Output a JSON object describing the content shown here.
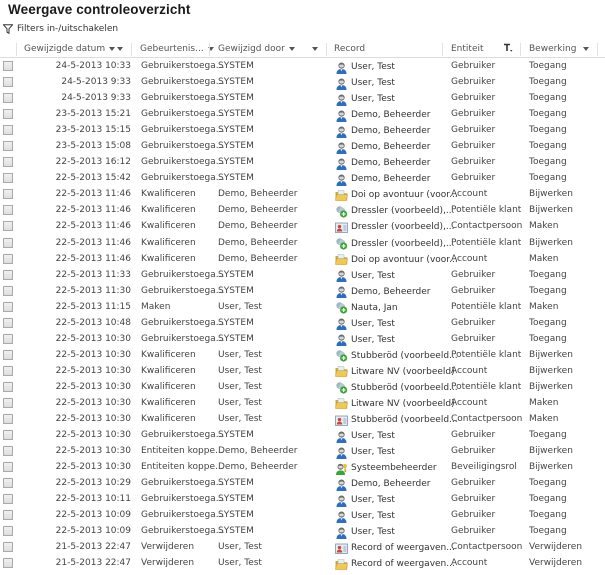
{
  "page": {
    "title": "Weergave controleoverzicht",
    "filter_toggle_label": "Filters in-/uitschakelen"
  },
  "colors": {
    "user_icon_blue": "#2b6fc2",
    "user_icon_gray": "#6b6b6b",
    "folder_yellow": "#f2c94c",
    "lead_green": "#38a832",
    "contact_red": "#c9493a"
  },
  "columns": [
    {
      "key": "date",
      "label": "Gewijzigde datum",
      "sortable": true
    },
    {
      "key": "event",
      "label": "Gebeurtenis...",
      "sortable": true
    },
    {
      "key": "changed_by",
      "label": "Gewijzigd door",
      "sortable": true
    },
    {
      "key": "record",
      "label": "Record",
      "sortable": false
    },
    {
      "key": "entity",
      "label": "Entiteit",
      "filter_active": true
    },
    {
      "key": "operation",
      "label": "Bewerking",
      "sortable": false
    }
  ],
  "rows": [
    {
      "date": "24-5-2013 10:33",
      "event": "Gebruikerstoega...",
      "changed_by": "SYSTEM",
      "record_icon": "user-icon",
      "record": "User, Test",
      "entity": "Gebruiker",
      "operation": "Toegang"
    },
    {
      "date": "24-5-2013 9:33",
      "event": "Gebruikerstoega...",
      "changed_by": "SYSTEM",
      "record_icon": "user-icon",
      "record": "User, Test",
      "entity": "Gebruiker",
      "operation": "Toegang"
    },
    {
      "date": "24-5-2013 9:33",
      "event": "Gebruikerstoega...",
      "changed_by": "SYSTEM",
      "record_icon": "user-icon",
      "record": "User, Test",
      "entity": "Gebruiker",
      "operation": "Toegang"
    },
    {
      "date": "23-5-2013 15:21",
      "event": "Gebruikerstoega...",
      "changed_by": "SYSTEM",
      "record_icon": "user-icon",
      "record": "Demo, Beheerder",
      "entity": "Gebruiker",
      "operation": "Toegang"
    },
    {
      "date": "23-5-2013 15:15",
      "event": "Gebruikerstoega...",
      "changed_by": "SYSTEM",
      "record_icon": "user-icon",
      "record": "Demo, Beheerder",
      "entity": "Gebruiker",
      "operation": "Toegang"
    },
    {
      "date": "23-5-2013 15:08",
      "event": "Gebruikerstoega...",
      "changed_by": "SYSTEM",
      "record_icon": "user-icon",
      "record": "Demo, Beheerder",
      "entity": "Gebruiker",
      "operation": "Toegang"
    },
    {
      "date": "22-5-2013 16:12",
      "event": "Gebruikerstoega...",
      "changed_by": "SYSTEM",
      "record_icon": "user-icon",
      "record": "Demo, Beheerder",
      "entity": "Gebruiker",
      "operation": "Toegang"
    },
    {
      "date": "22-5-2013 15:42",
      "event": "Gebruikerstoega...",
      "changed_by": "SYSTEM",
      "record_icon": "user-icon",
      "record": "Demo, Beheerder",
      "entity": "Gebruiker",
      "operation": "Toegang"
    },
    {
      "date": "22-5-2013 11:46",
      "event": "Kwalificeren",
      "changed_by": "Demo, Beheerder",
      "record_icon": "account-icon",
      "record": "Doi op avontuur (voor...",
      "entity": "Account",
      "operation": "Bijwerken"
    },
    {
      "date": "22-5-2013 11:46",
      "event": "Kwalificeren",
      "changed_by": "Demo, Beheerder",
      "record_icon": "lead-icon",
      "record": "Dressler (voorbeeld),...",
      "entity": "Potentiële klant",
      "operation": "Bijwerken"
    },
    {
      "date": "22-5-2013 11:46",
      "event": "Kwalificeren",
      "changed_by": "Demo, Beheerder",
      "record_icon": "contact-icon",
      "record": "Dressler (voorbeeld),...",
      "entity": "Contactpersoon",
      "operation": "Maken"
    },
    {
      "date": "22-5-2013 11:46",
      "event": "Kwalificeren",
      "changed_by": "Demo, Beheerder",
      "record_icon": "lead-icon",
      "record": "Dressler (voorbeeld),...",
      "entity": "Potentiële klant",
      "operation": "Bijwerken"
    },
    {
      "date": "22-5-2013 11:46",
      "event": "Kwalificeren",
      "changed_by": "Demo, Beheerder",
      "record_icon": "account-icon",
      "record": "Doi op avontuur (voor...",
      "entity": "Account",
      "operation": "Maken"
    },
    {
      "date": "22-5-2013 11:33",
      "event": "Gebruikerstoega...",
      "changed_by": "SYSTEM",
      "record_icon": "user-icon",
      "record": "User, Test",
      "entity": "Gebruiker",
      "operation": "Toegang"
    },
    {
      "date": "22-5-2013 11:30",
      "event": "Gebruikerstoega...",
      "changed_by": "SYSTEM",
      "record_icon": "user-icon",
      "record": "Demo, Beheerder",
      "entity": "Gebruiker",
      "operation": "Toegang"
    },
    {
      "date": "22-5-2013 11:15",
      "event": "Maken",
      "changed_by": "User, Test",
      "record_icon": "lead-icon",
      "record": "Nauta, Jan",
      "entity": "Potentiële klant",
      "operation": "Maken"
    },
    {
      "date": "22-5-2013 10:48",
      "event": "Gebruikerstoega...",
      "changed_by": "SYSTEM",
      "record_icon": "user-icon",
      "record": "User, Test",
      "entity": "Gebruiker",
      "operation": "Toegang"
    },
    {
      "date": "22-5-2013 10:30",
      "event": "Gebruikerstoega...",
      "changed_by": "SYSTEM",
      "record_icon": "user-icon",
      "record": "User, Test",
      "entity": "Gebruiker",
      "operation": "Toegang"
    },
    {
      "date": "22-5-2013 10:30",
      "event": "Kwalificeren",
      "changed_by": "User, Test",
      "record_icon": "lead-icon",
      "record": "Stubberöd (voorbeeld...",
      "entity": "Potentiële klant",
      "operation": "Bijwerken"
    },
    {
      "date": "22-5-2013 10:30",
      "event": "Kwalificeren",
      "changed_by": "User, Test",
      "record_icon": "account-icon",
      "record": "Litware NV (voorbeeld)",
      "entity": "Account",
      "operation": "Bijwerken"
    },
    {
      "date": "22-5-2013 10:30",
      "event": "Kwalificeren",
      "changed_by": "User, Test",
      "record_icon": "lead-icon",
      "record": "Stubberöd (voorbeeld...",
      "entity": "Potentiële klant",
      "operation": "Bijwerken"
    },
    {
      "date": "22-5-2013 10:30",
      "event": "Kwalificeren",
      "changed_by": "User, Test",
      "record_icon": "account-icon",
      "record": "Litware NV (voorbeeld)",
      "entity": "Account",
      "operation": "Maken"
    },
    {
      "date": "22-5-2013 10:30",
      "event": "Kwalificeren",
      "changed_by": "User, Test",
      "record_icon": "contact-icon",
      "record": "Stubberöd (voorbeeld...",
      "entity": "Contactpersoon",
      "operation": "Maken"
    },
    {
      "date": "22-5-2013 10:30",
      "event": "Gebruikerstoega...",
      "changed_by": "SYSTEM",
      "record_icon": "user-icon",
      "record": "User, Test",
      "entity": "Gebruiker",
      "operation": "Toegang"
    },
    {
      "date": "22-5-2013 10:30",
      "event": "Entiteiten koppe...",
      "changed_by": "Demo, Beheerder",
      "record_icon": "user-icon",
      "record": "User, Test",
      "entity": "Gebruiker",
      "operation": "Bijwerken"
    },
    {
      "date": "22-5-2013 10:30",
      "event": "Entiteiten koppe...",
      "changed_by": "Demo, Beheerder",
      "record_icon": "security-role-icon",
      "record": "Systeembeheerder",
      "entity": "Beveiligingsrol",
      "operation": "Bijwerken"
    },
    {
      "date": "22-5-2013 10:29",
      "event": "Gebruikerstoega...",
      "changed_by": "SYSTEM",
      "record_icon": "user-icon",
      "record": "Demo, Beheerder",
      "entity": "Gebruiker",
      "operation": "Toegang"
    },
    {
      "date": "22-5-2013 10:11",
      "event": "Gebruikerstoega...",
      "changed_by": "SYSTEM",
      "record_icon": "user-icon",
      "record": "User, Test",
      "entity": "Gebruiker",
      "operation": "Toegang"
    },
    {
      "date": "22-5-2013 10:09",
      "event": "Gebruikerstoega...",
      "changed_by": "SYSTEM",
      "record_icon": "user-icon",
      "record": "User, Test",
      "entity": "Gebruiker",
      "operation": "Toegang"
    },
    {
      "date": "22-5-2013 10:09",
      "event": "Gebruikerstoega...",
      "changed_by": "SYSTEM",
      "record_icon": "user-icon",
      "record": "User, Test",
      "entity": "Gebruiker",
      "operation": "Toegang"
    },
    {
      "date": "21-5-2013 22:47",
      "event": "Verwijderen",
      "changed_by": "User, Test",
      "record_icon": "contact-icon",
      "record": "Record of weergaven...",
      "entity": "Contactpersoon",
      "operation": "Verwijderen"
    },
    {
      "date": "21-5-2013 22:47",
      "event": "Verwijderen",
      "changed_by": "User, Test",
      "record_icon": "account-icon",
      "record": "Record of weergaven...",
      "entity": "Account",
      "operation": "Verwijderen"
    }
  ]
}
